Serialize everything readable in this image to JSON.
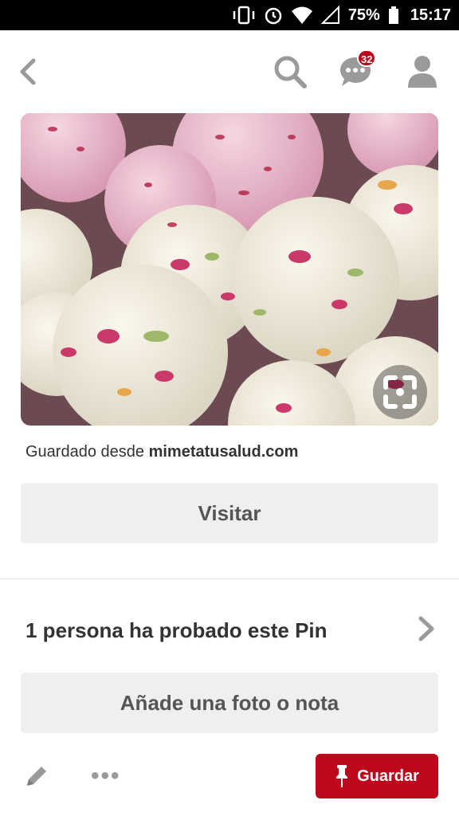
{
  "status_bar": {
    "battery_percent": "75%",
    "time": "15:17"
  },
  "header": {
    "notification_count": "32",
    "icons": [
      "back-icon",
      "search-icon",
      "chat-icon",
      "profile-icon"
    ]
  },
  "pin": {
    "saved_from_prefix": "Guardado desde",
    "saved_from_domain": "mimetatusalud.com",
    "visit_label": "Visitar"
  },
  "tried": {
    "text": "1 persona ha probado este Pin",
    "add_note_label": "Añade una foto o nota"
  },
  "footer": {
    "save_label": "Guardar",
    "more_label": "•••"
  },
  "colors": {
    "accent": "#bd081c",
    "button_gray": "#efefef",
    "text_dark": "#333333"
  }
}
